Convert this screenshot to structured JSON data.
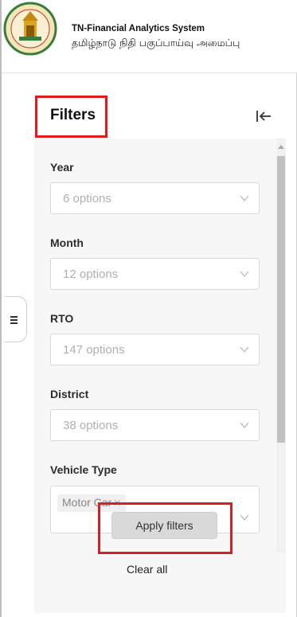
{
  "header": {
    "title": "TN-Financial Analytics System",
    "subtitle": "தமிழ்நாடு நிதி பகுப்பாய்வு அமைப்பு"
  },
  "filters": {
    "heading": "Filters",
    "fields": [
      {
        "label": "Year",
        "placeholder": "6 options"
      },
      {
        "label": "Month",
        "placeholder": "12 options"
      },
      {
        "label": "RTO",
        "placeholder": "147 options"
      },
      {
        "label": "District",
        "placeholder": "38 options"
      },
      {
        "label": "Vehicle Type",
        "selected_tag": "Motor Car"
      }
    ],
    "apply_label": "Apply filters",
    "clear_label": "Clear all"
  },
  "icons": {
    "collapse": "collapse-left-icon",
    "menu": "menu-bars-icon",
    "chevron": "chevron-down-icon",
    "emblem": "tamil-nadu-emblem"
  },
  "colors": {
    "highlight": "#e01b1b",
    "button": "#d9d9d9"
  }
}
